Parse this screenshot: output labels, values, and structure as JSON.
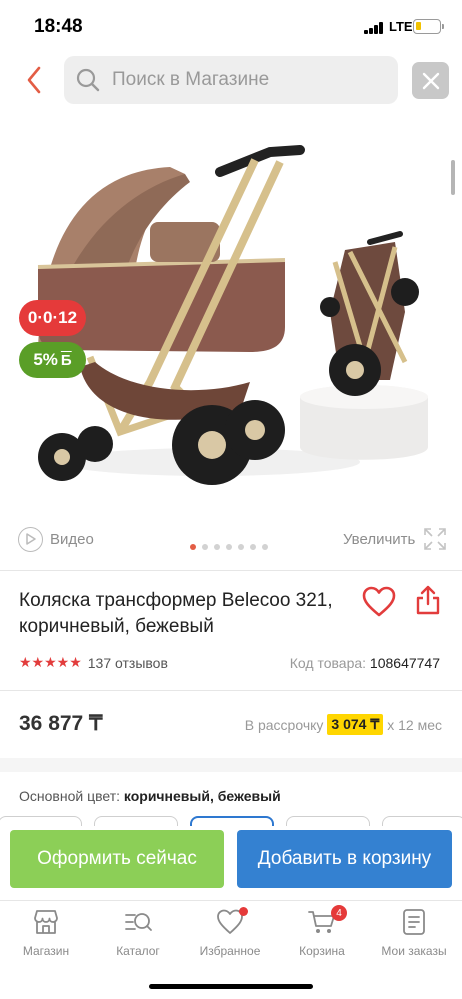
{
  "status_bar": {
    "time": "18:48",
    "network": "LTE"
  },
  "search": {
    "placeholder": "Поиск в Магазине"
  },
  "gallery": {
    "badge_age": "0·0·12",
    "badge_bonus_value": "5%",
    "badge_bonus_currency": "Б",
    "video_label": "Видео",
    "zoom_label": "Увеличить",
    "dots_total": 7,
    "dots_active": 1
  },
  "product": {
    "title": "Коляска трансформер Belecoo 321, коричневый, бежевый",
    "stars": "★★★★★",
    "reviews": "137 отзывов",
    "sku_label": "Код товара:",
    "sku_value": "108647747",
    "price": "36 877 ₸",
    "installment_label": "В рассрочку",
    "installment_amount": "3 074 ₸",
    "installment_term": "x 12 мес",
    "color_label": "Основной цвет:",
    "color_value": "коричневый, бежевый"
  },
  "actions": {
    "checkout": "Оформить сейчас",
    "add_to_cart": "Добавить в корзину"
  },
  "tabbar": {
    "items": [
      {
        "label": "Магазин",
        "icon": "shop-icon"
      },
      {
        "label": "Каталог",
        "icon": "catalog-search-icon"
      },
      {
        "label": "Избранное",
        "icon": "heart-icon"
      },
      {
        "label": "Корзина",
        "icon": "cart-icon",
        "badge": "4"
      },
      {
        "label": "Мои заказы",
        "icon": "orders-icon"
      }
    ]
  },
  "colors": {
    "accent_red": "#e53a3a",
    "checkout_green": "#8ccf57",
    "cart_blue": "#3481d1",
    "installment_yellow": "#ffd600"
  }
}
